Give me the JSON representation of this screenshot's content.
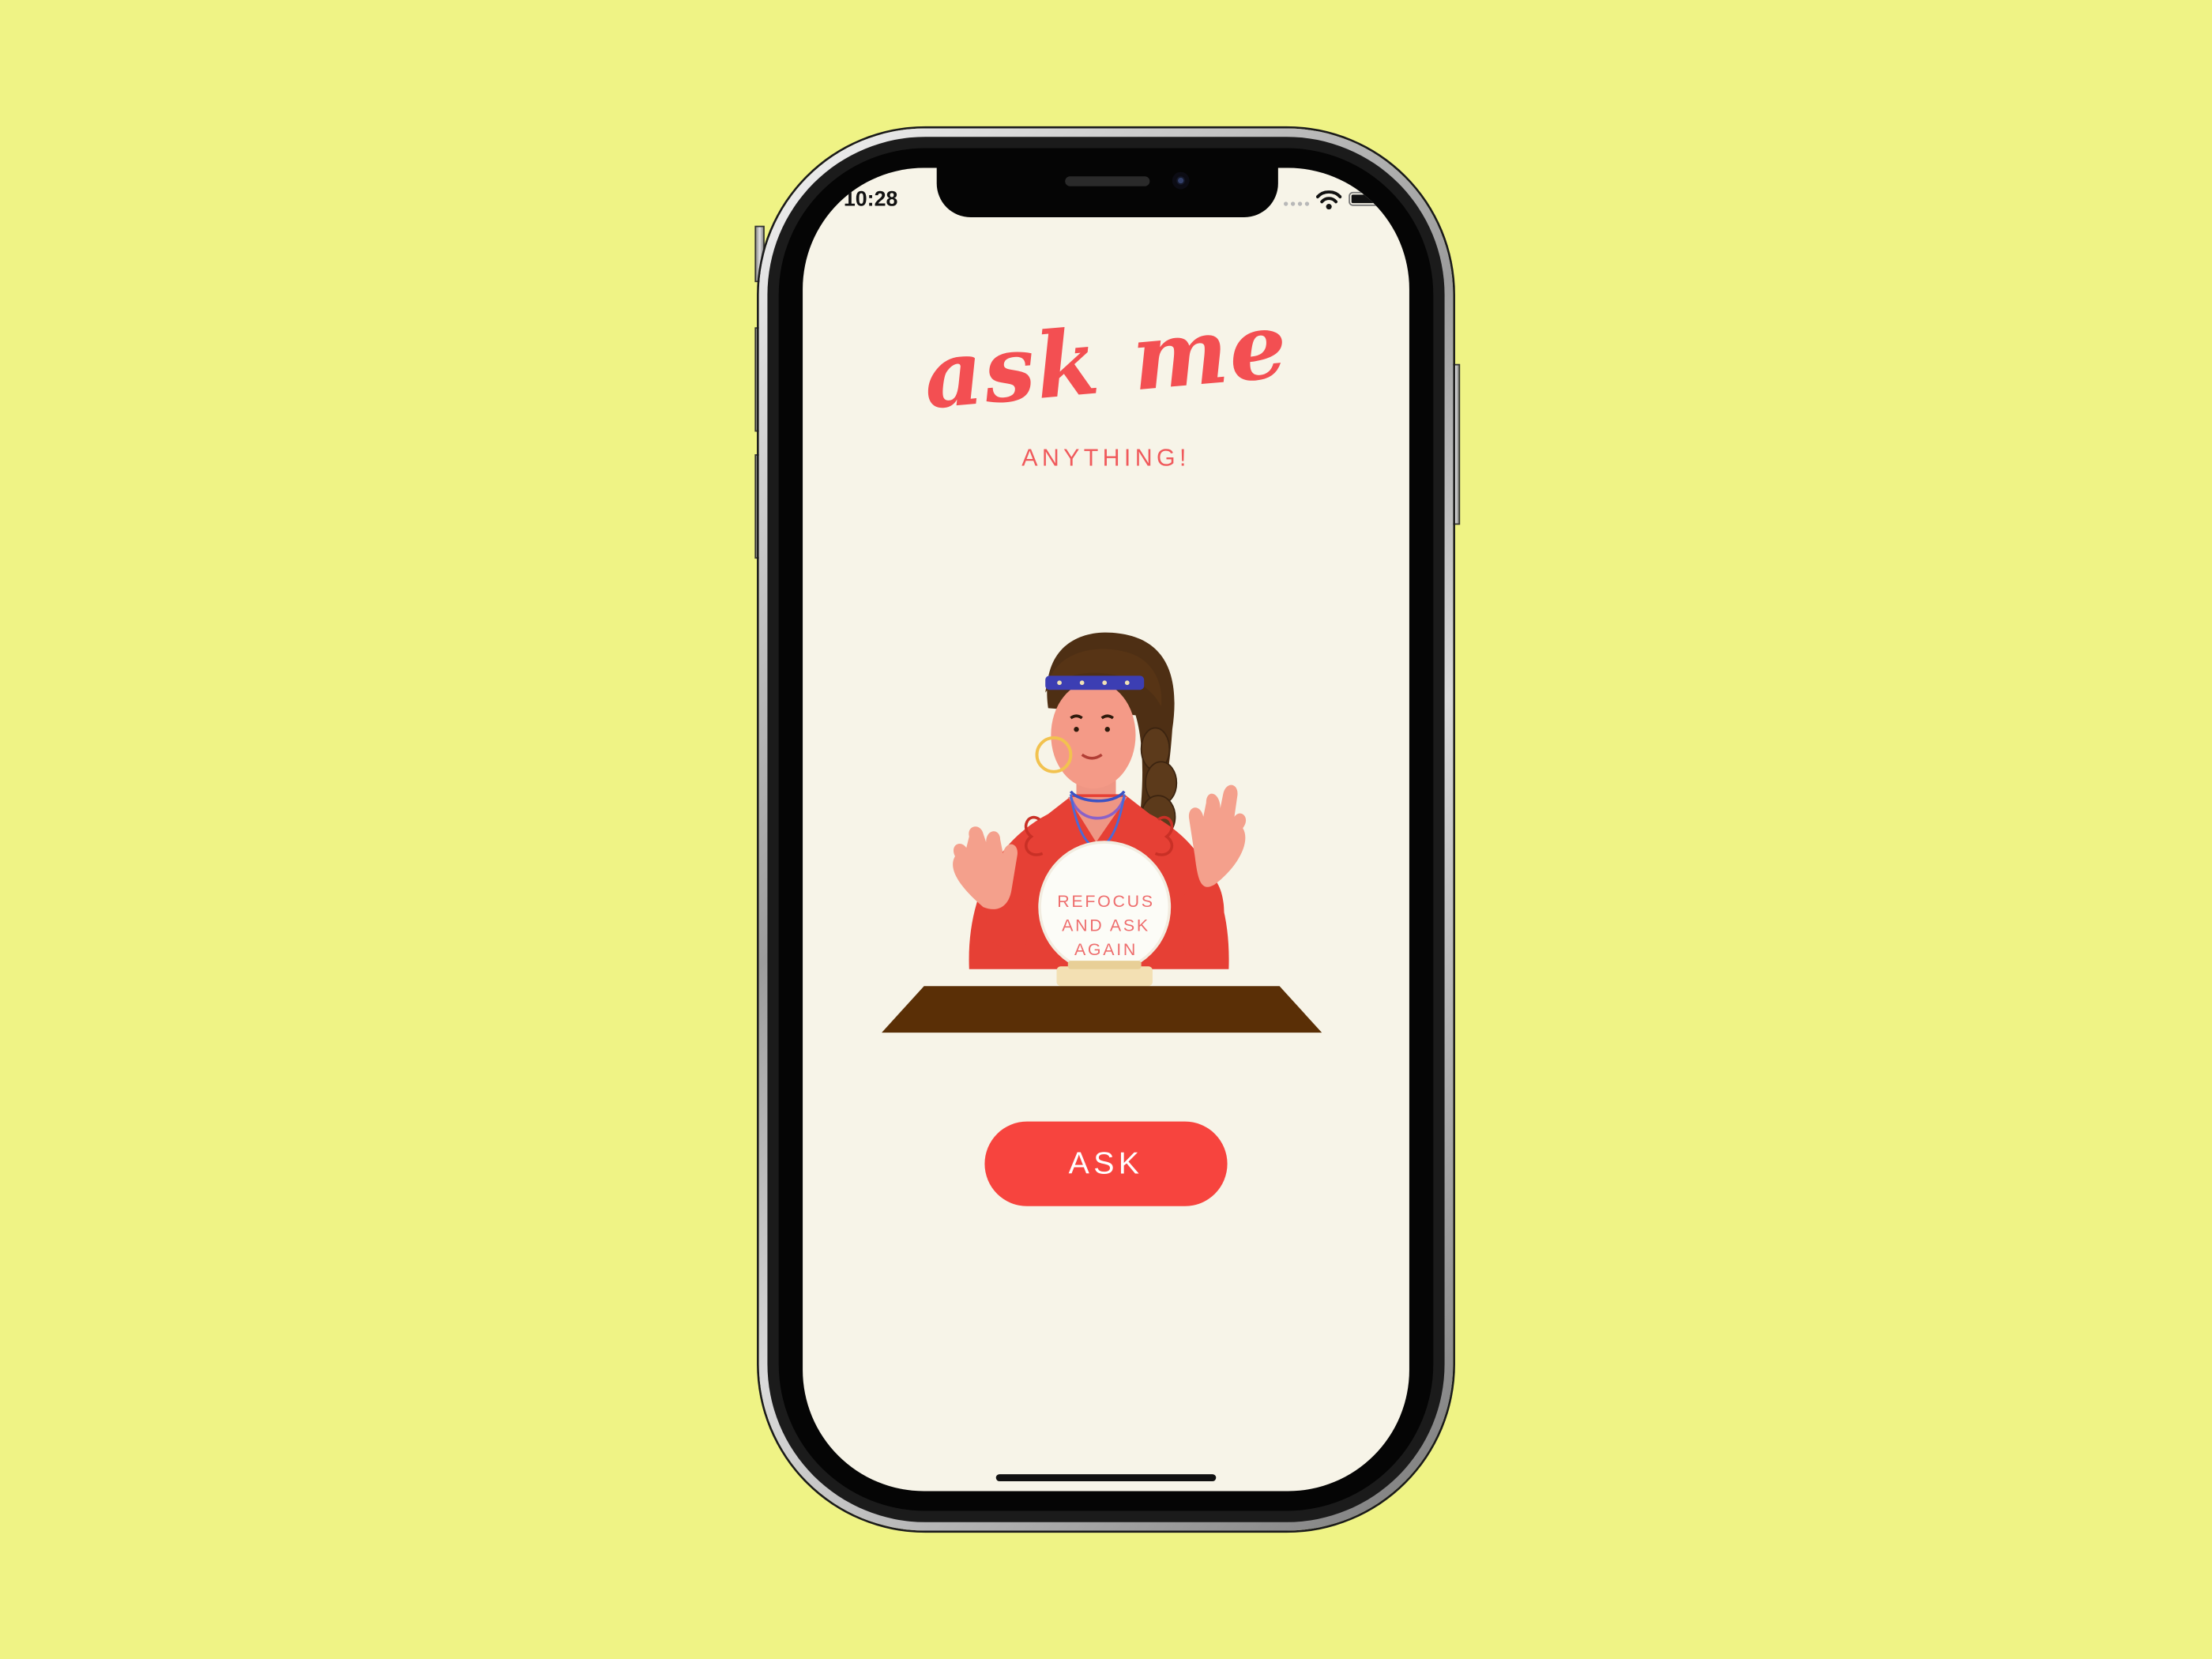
{
  "status_bar": {
    "time": "10:28",
    "signal_icon": "cellular-signal-icon",
    "wifi_icon": "wifi-icon",
    "battery_icon": "battery-icon",
    "battery_level": 1.0
  },
  "app": {
    "title": "ask me",
    "subtitle": "ANYTHING!",
    "illustration": "fortune-teller-illustration",
    "answer": "REFOCUS AND ASK AGAIN",
    "ask_button_label": "ASK"
  },
  "colors": {
    "background": "#eff385",
    "screen": "#f7f4e8",
    "accent": "#f34f52",
    "button": "#f7443e"
  }
}
